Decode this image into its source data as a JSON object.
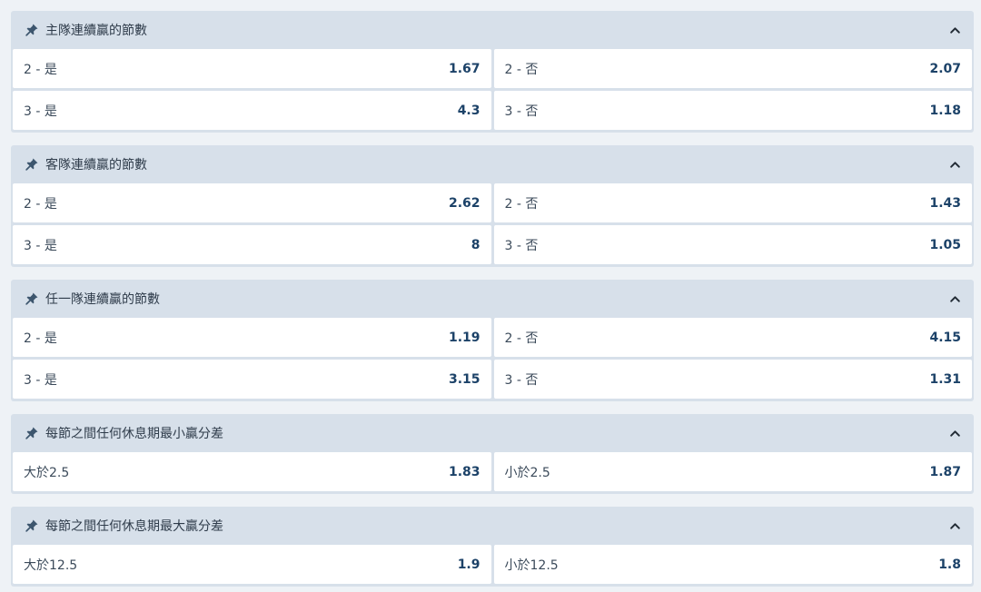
{
  "colors": {
    "background": "#eef2f6",
    "header": "#d7e0ea",
    "cell": "#ffffff",
    "price": "#1c4268",
    "label": "#3b4a5a"
  },
  "icons": {
    "pin": "pin-icon",
    "collapse": "chevron-up-icon"
  },
  "markets": [
    {
      "title": "主隊連續贏的節數",
      "rows": [
        [
          {
            "label": "2 - 是",
            "price": "1.67"
          },
          {
            "label": "2 - 否",
            "price": "2.07"
          }
        ],
        [
          {
            "label": "3 - 是",
            "price": "4.3"
          },
          {
            "label": "3 - 否",
            "price": "1.18"
          }
        ]
      ]
    },
    {
      "title": "客隊連續贏的節數",
      "rows": [
        [
          {
            "label": "2 - 是",
            "price": "2.62"
          },
          {
            "label": "2 - 否",
            "price": "1.43"
          }
        ],
        [
          {
            "label": "3 - 是",
            "price": "8"
          },
          {
            "label": "3 - 否",
            "price": "1.05"
          }
        ]
      ]
    },
    {
      "title": "任一隊連續贏的節數",
      "rows": [
        [
          {
            "label": "2 - 是",
            "price": "1.19"
          },
          {
            "label": "2 - 否",
            "price": "4.15"
          }
        ],
        [
          {
            "label": "3 - 是",
            "price": "3.15"
          },
          {
            "label": "3 - 否",
            "price": "1.31"
          }
        ]
      ]
    },
    {
      "title": "每節之間任何休息期最小贏分差",
      "rows": [
        [
          {
            "label": "大於2.5",
            "price": "1.83"
          },
          {
            "label": "小於2.5",
            "price": "1.87"
          }
        ]
      ]
    },
    {
      "title": "每節之間任何休息期最大贏分差",
      "rows": [
        [
          {
            "label": "大於12.5",
            "price": "1.9"
          },
          {
            "label": "小於12.5",
            "price": "1.8"
          }
        ]
      ]
    }
  ]
}
